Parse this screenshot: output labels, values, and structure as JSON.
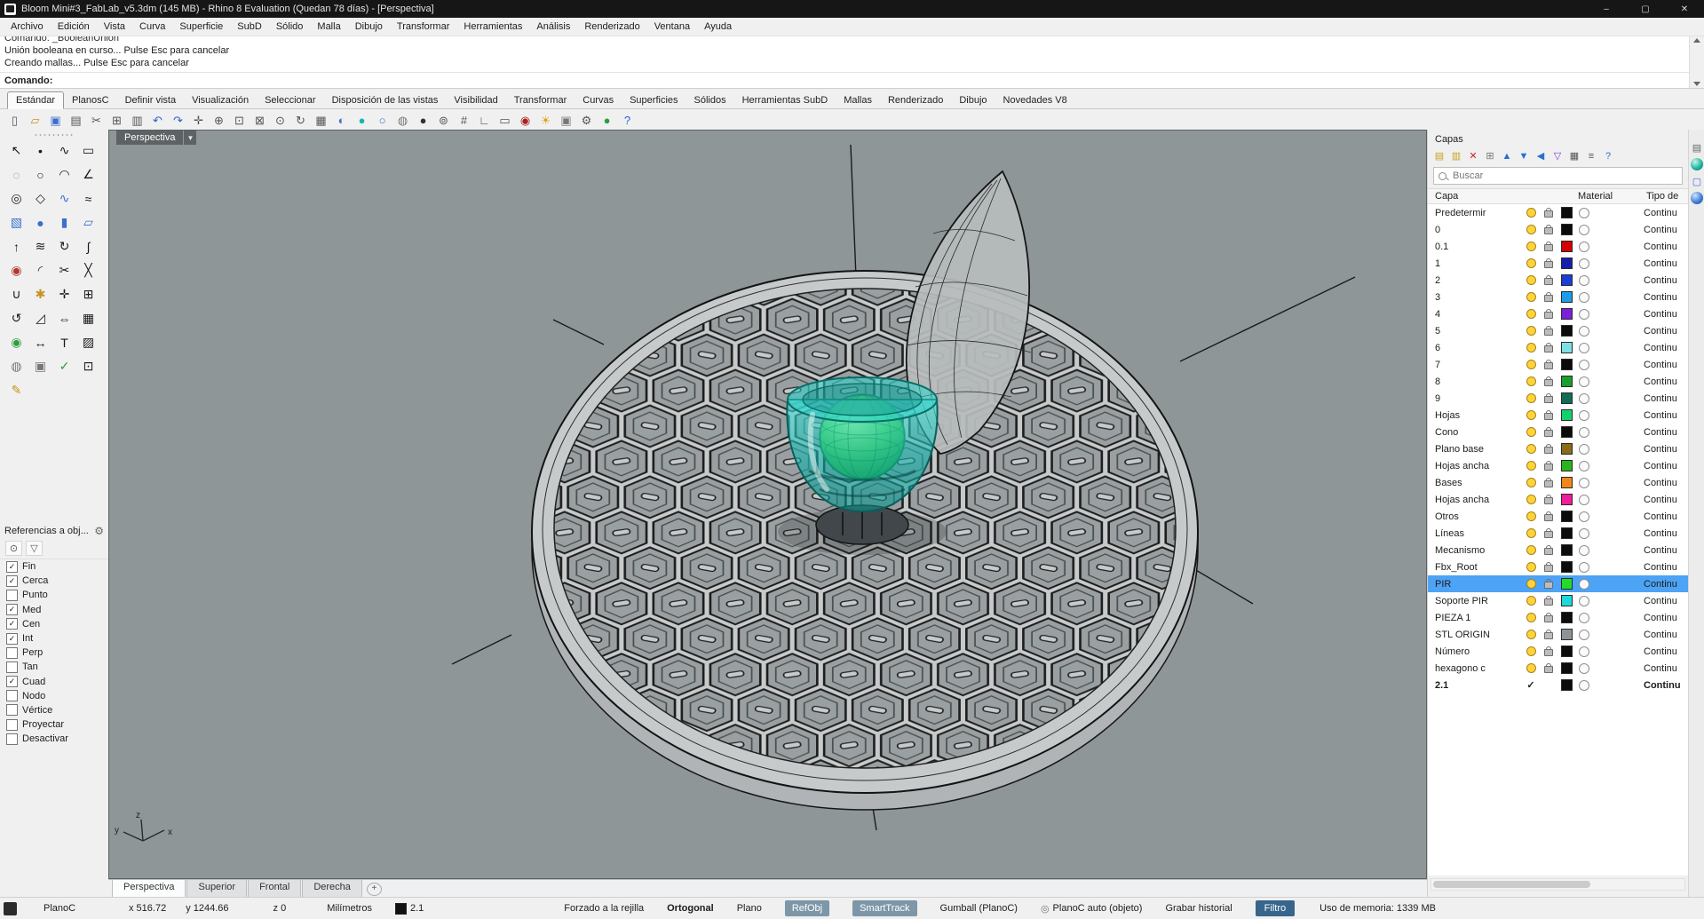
{
  "window": {
    "title": "Bloom Mini#3_FabLab_v5.3dm (145 MB) - Rhino 8 Evaluation (Quedan 78 días) - [Perspectiva]",
    "controls": {
      "minimize": "–",
      "maximize": "▢",
      "close": "✕"
    }
  },
  "menubar": {
    "items": [
      "Archivo",
      "Edición",
      "Vista",
      "Curva",
      "Superficie",
      "SubD",
      "Sólido",
      "Malla",
      "Dibujo",
      "Transformar",
      "Herramientas",
      "Análisis",
      "Renderizado",
      "Ventana",
      "Ayuda"
    ]
  },
  "command_area": {
    "history": [
      "Comando: _BooleanUnion",
      "Unión booleana en curso... Pulse Esc para cancelar",
      "Creando mallas... Pulse Esc para cancelar"
    ],
    "prompt": "Comando:"
  },
  "ribbon": {
    "active": "Estándar",
    "tabs": [
      "Estándar",
      "PlanosC",
      "Definir vista",
      "Visualización",
      "Seleccionar",
      "Disposición de las vistas",
      "Visibilidad",
      "Transformar",
      "Curvas",
      "Superficies",
      "Sólidos",
      "Herramientas SubD",
      "Mallas",
      "Renderizado",
      "Dibujo",
      "Novedades V8"
    ]
  },
  "toolbar": {
    "icons": [
      {
        "name": "new-file",
        "glyph": "▯",
        "color": "#555555"
      },
      {
        "name": "open-file",
        "glyph": "▱",
        "color": "#c8921e"
      },
      {
        "name": "save",
        "glyph": "▣",
        "color": "#3a6fd0"
      },
      {
        "name": "print",
        "glyph": "▤",
        "color": "#555555"
      },
      {
        "name": "cut",
        "glyph": "✂",
        "color": "#555555"
      },
      {
        "name": "copy",
        "glyph": "⊞",
        "color": "#555555"
      },
      {
        "name": "paste",
        "glyph": "▥",
        "color": "#555555"
      },
      {
        "name": "undo",
        "glyph": "↶",
        "color": "#2a5fd0"
      },
      {
        "name": "redo",
        "glyph": "↷",
        "color": "#2a5fd0"
      },
      {
        "name": "pan",
        "glyph": "✛",
        "color": "#555555"
      },
      {
        "name": "zoom-dynamic",
        "glyph": "⊕",
        "color": "#555555"
      },
      {
        "name": "zoom-window",
        "glyph": "⊡",
        "color": "#555555"
      },
      {
        "name": "zoom-extents",
        "glyph": "⊠",
        "color": "#555555"
      },
      {
        "name": "zoom-selected",
        "glyph": "⊙",
        "color": "#555555"
      },
      {
        "name": "rotate-view",
        "glyph": "↻",
        "color": "#555555"
      },
      {
        "name": "named-views",
        "glyph": "▦",
        "color": "#555555"
      },
      {
        "name": "shaded-viewport",
        "glyph": "◐",
        "color": "#3a6fd0"
      },
      {
        "name": "render-sphere",
        "glyph": "●",
        "color": "#18b6ad"
      },
      {
        "name": "wireframe-sphere",
        "glyph": "○",
        "color": "#3a6fd0"
      },
      {
        "name": "ghosted-sphere",
        "glyph": "◍",
        "color": "#777777"
      },
      {
        "name": "raytrace-sphere",
        "glyph": "●",
        "color": "#333333"
      },
      {
        "name": "object-snap",
        "glyph": "⊚",
        "color": "#555555"
      },
      {
        "name": "grid-snap",
        "glyph": "#",
        "color": "#555555"
      },
      {
        "name": "ortho-toggle",
        "glyph": "∟",
        "color": "#555555"
      },
      {
        "name": "planar-mode",
        "glyph": "▭",
        "color": "#555555"
      },
      {
        "name": "record-history",
        "glyph": "◉",
        "color": "#b02020"
      },
      {
        "name": "lamp",
        "glyph": "☀",
        "color": "#e0a010"
      },
      {
        "name": "lock-objects",
        "glyph": "▣",
        "color": "#777777"
      },
      {
        "name": "options-gear",
        "glyph": "⚙",
        "color": "#555555"
      },
      {
        "name": "earth-render",
        "glyph": "●",
        "color": "#2c9e3f"
      },
      {
        "name": "help",
        "glyph": "?",
        "color": "#2a5fd0"
      }
    ]
  },
  "palette": {
    "icons": [
      {
        "name": "select-arrow",
        "glyph": "↖",
        "color": "#1a1a1a"
      },
      {
        "name": "point",
        "glyph": "•",
        "color": "#1a1a1a"
      },
      {
        "name": "control-point-curve",
        "glyph": "∿",
        "color": "#1a1a1a"
      },
      {
        "name": "rectangle",
        "glyph": "▭",
        "color": "#1a1a1a"
      },
      {
        "name": "lasso",
        "glyph": "◌",
        "color": "#777777"
      },
      {
        "name": "circle",
        "glyph": "○",
        "color": "#1a1a1a"
      },
      {
        "name": "arc",
        "glyph": "◠",
        "color": "#1a1a1a"
      },
      {
        "name": "polyline",
        "glyph": "∠",
        "color": "#1a1a1a"
      },
      {
        "name": "ellipse",
        "glyph": "◎",
        "color": "#1a1a1a"
      },
      {
        "name": "polygon",
        "glyph": "◇",
        "color": "#1a1a1a"
      },
      {
        "name": "freeform-curve",
        "glyph": "∿",
        "color": "#3a6fd0"
      },
      {
        "name": "offset-curve",
        "glyph": "≈",
        "color": "#1a1a1a"
      },
      {
        "name": "box",
        "glyph": "▧",
        "color": "#3a6fd0"
      },
      {
        "name": "sphere",
        "glyph": "●",
        "color": "#3a6fd0"
      },
      {
        "name": "cylinder",
        "glyph": "▮",
        "color": "#3a6fd0"
      },
      {
        "name": "plane",
        "glyph": "▱",
        "color": "#3a6fd0"
      },
      {
        "name": "extrude",
        "glyph": "↑",
        "color": "#1a1a1a"
      },
      {
        "name": "loft",
        "glyph": "≋",
        "color": "#1a1a1a"
      },
      {
        "name": "revolve",
        "glyph": "↻",
        "color": "#1a1a1a"
      },
      {
        "name": "sweep",
        "glyph": "∫",
        "color": "#1a1a1a"
      },
      {
        "name": "boolean-union",
        "glyph": "◉",
        "color": "#b0352c"
      },
      {
        "name": "fillet",
        "glyph": "◜",
        "color": "#1a1a1a"
      },
      {
        "name": "trim",
        "glyph": "✂",
        "color": "#1a1a1a"
      },
      {
        "name": "split",
        "glyph": "╳",
        "color": "#1a1a1a"
      },
      {
        "name": "join",
        "glyph": "∪",
        "color": "#1a1a1a"
      },
      {
        "name": "explode",
        "glyph": "✱",
        "color": "#c8921e"
      },
      {
        "name": "move",
        "glyph": "✛",
        "color": "#1a1a1a"
      },
      {
        "name": "copy-object",
        "glyph": "⊞",
        "color": "#1a1a1a"
      },
      {
        "name": "rotate",
        "glyph": "↺",
        "color": "#1a1a1a"
      },
      {
        "name": "scale",
        "glyph": "◿",
        "color": "#1a1a1a"
      },
      {
        "name": "mirror",
        "glyph": "⇔",
        "color": "#1a1a1a"
      },
      {
        "name": "array",
        "glyph": "▦",
        "color": "#1a1a1a"
      },
      {
        "name": "gumball",
        "glyph": "◉",
        "color": "#2c9e3f"
      },
      {
        "name": "dimension",
        "glyph": "↔",
        "color": "#1a1a1a"
      },
      {
        "name": "text",
        "glyph": "T",
        "color": "#1a1a1a"
      },
      {
        "name": "hatch",
        "glyph": "▨",
        "color": "#1a1a1a"
      },
      {
        "name": "hide",
        "glyph": "◍",
        "color": "#777777"
      },
      {
        "name": "lock",
        "glyph": "▣",
        "color": "#777777"
      },
      {
        "name": "check",
        "glyph": "✓",
        "color": "#2c9e3f"
      },
      {
        "name": "group",
        "glyph": "⊡",
        "color": "#1a1a1a"
      },
      {
        "name": "annotate-pencil",
        "glyph": "✎",
        "color": "#c8921e"
      }
    ]
  },
  "osnap": {
    "title": "Referencias a obj...",
    "gear_glyph": "⚙",
    "filter_icons": [
      {
        "name": "project-icon",
        "glyph": "⊙",
        "color": "#555555"
      },
      {
        "name": "filter-icon",
        "glyph": "▽",
        "color": "#555555"
      }
    ],
    "items": [
      {
        "label": "Fin",
        "checked": true
      },
      {
        "label": "Cerca",
        "checked": true
      },
      {
        "label": "Punto",
        "checked": false
      },
      {
        "label": "Med",
        "checked": true
      },
      {
        "label": "Cen",
        "checked": true
      },
      {
        "label": "Int",
        "checked": true
      },
      {
        "label": "Perp",
        "checked": false
      },
      {
        "label": "Tan",
        "checked": false
      },
      {
        "label": "Cuad",
        "checked": true
      },
      {
        "label": "Nodo",
        "checked": false
      },
      {
        "label": "Vértice",
        "checked": false
      },
      {
        "label": "Proyectar",
        "checked": false
      },
      {
        "label": "Desactivar",
        "checked": false
      }
    ]
  },
  "viewport": {
    "label": "Perspectiva",
    "dropdown_glyph": "▼",
    "axis": {
      "x": "x",
      "y": "y",
      "z": "z"
    },
    "tabs": [
      {
        "label": "Perspectiva",
        "active": true
      },
      {
        "label": "Superior",
        "active": false
      },
      {
        "label": "Frontal",
        "active": false
      },
      {
        "label": "Derecha",
        "active": false
      }
    ],
    "add_label": "+"
  },
  "layers": {
    "title": "Capas",
    "search_placeholder": "Buscar",
    "columns": [
      "Capa",
      "Material",
      "Tipo de"
    ],
    "toolbar": [
      {
        "name": "new-layer",
        "glyph": "▤",
        "color": "#c8a21e"
      },
      {
        "name": "new-sublayer",
        "glyph": "▥",
        "color": "#c8a21e"
      },
      {
        "name": "delete-layer",
        "glyph": "✕",
        "color": "#cc2222"
      },
      {
        "name": "match-layer",
        "glyph": "⊞",
        "color": "#777777"
      },
      {
        "name": "move-up",
        "glyph": "▲",
        "color": "#2a6fd0"
      },
      {
        "name": "move-down",
        "glyph": "▼",
        "color": "#2a6fd0"
      },
      {
        "name": "collapse",
        "glyph": "◀",
        "color": "#2a6fd0"
      },
      {
        "name": "filter-funnel",
        "glyph": "▽",
        "color": "#7a3fd0"
      },
      {
        "name": "grid-view",
        "glyph": "▦",
        "color": "#555555"
      },
      {
        "name": "list-menu",
        "glyph": "≡",
        "color": "#555555"
      },
      {
        "name": "help",
        "glyph": "?",
        "color": "#2a6fd0"
      }
    ],
    "rows": [
      {
        "name": "Predetermir",
        "color": "#0b0b0b",
        "linetype": "Continu",
        "selected": false,
        "current": false
      },
      {
        "name": "0",
        "color": "#0b0b0b",
        "linetype": "Continu",
        "selected": false,
        "current": false
      },
      {
        "name": "0.1",
        "color": "#d40000",
        "linetype": "Continu",
        "selected": false,
        "current": false
      },
      {
        "name": "1",
        "color": "#141fae",
        "linetype": "Continu",
        "selected": false,
        "current": false
      },
      {
        "name": "2",
        "color": "#1a3fd4",
        "linetype": "Continu",
        "selected": false,
        "current": false
      },
      {
        "name": "3",
        "color": "#1e9ce8",
        "linetype": "Continu",
        "selected": false,
        "current": false
      },
      {
        "name": "4",
        "color": "#7b20d8",
        "linetype": "Continu",
        "selected": false,
        "current": false
      },
      {
        "name": "5",
        "color": "#0b0b0b",
        "linetype": "Continu",
        "selected": false,
        "current": false
      },
      {
        "name": "6",
        "color": "#7ee0e6",
        "linetype": "Continu",
        "selected": false,
        "current": false
      },
      {
        "name": "7",
        "color": "#0b0b0b",
        "linetype": "Continu",
        "selected": false,
        "current": false
      },
      {
        "name": "8",
        "color": "#1a9e2e",
        "linetype": "Continu",
        "selected": false,
        "current": false
      },
      {
        "name": "9",
        "color": "#0e6e54",
        "linetype": "Continu",
        "selected": false,
        "current": false
      },
      {
        "name": "Hojas",
        "color": "#13d06e",
        "linetype": "Continu",
        "selected": false,
        "current": false
      },
      {
        "name": "Cono",
        "color": "#0b0b0b",
        "linetype": "Continu",
        "selected": false,
        "current": false
      },
      {
        "name": "Plano base",
        "color": "#8a6c16",
        "linetype": "Continu",
        "selected": false,
        "current": false
      },
      {
        "name": "Hojas ancha",
        "color": "#2ab41e",
        "linetype": "Continu",
        "selected": false,
        "current": false
      },
      {
        "name": "Bases",
        "color": "#f08818",
        "linetype": "Continu",
        "selected": false,
        "current": false
      },
      {
        "name": "Hojas ancha",
        "color": "#ee1e9c",
        "linetype": "Continu",
        "selected": false,
        "current": false
      },
      {
        "name": "Otros",
        "color": "#0b0b0b",
        "linetype": "Continu",
        "selected": false,
        "current": false
      },
      {
        "name": "Líneas",
        "color": "#0b0b0b",
        "linetype": "Continu",
        "selected": false,
        "current": false
      },
      {
        "name": "Mecanismo",
        "color": "#0b0b0b",
        "linetype": "Continu",
        "selected": false,
        "current": false
      },
      {
        "name": "Fbx_Root",
        "color": "#0b0b0b",
        "linetype": "Continu",
        "selected": false,
        "current": false
      },
      {
        "name": "PIR",
        "color": "#23dc28",
        "linetype": "Continu",
        "selected": true,
        "current": false
      },
      {
        "name": "Soporte PIR",
        "color": "#1ed8dc",
        "linetype": "Continu",
        "selected": false,
        "current": false
      },
      {
        "name": "PIEZA 1",
        "color": "#0b0b0b",
        "linetype": "Continu",
        "selected": false,
        "current": false
      },
      {
        "name": "STL ORIGIN",
        "color": "#8e9396",
        "linetype": "Continu",
        "selected": false,
        "current": false
      },
      {
        "name": "Número",
        "color": "#0b0b0b",
        "linetype": "Continu",
        "selected": false,
        "current": false
      },
      {
        "name": "hexagono c",
        "color": "#0b0b0b",
        "linetype": "Continu",
        "selected": false,
        "current": false
      },
      {
        "name": "2.1",
        "color": "#0b0b0b",
        "linetype": "Continu",
        "selected": false,
        "current": true
      }
    ],
    "selection_color": "#4da3f5"
  },
  "rightstrip": {
    "icons": [
      {
        "name": "panels-icon",
        "glyph": "▤",
        "color": "#666666",
        "cls": ""
      },
      {
        "name": "render-preview-icon",
        "glyph": "",
        "cls": "ball ball-teal"
      },
      {
        "name": "display-icon",
        "glyph": "▢",
        "color": "#3a6fd0",
        "cls": ""
      },
      {
        "name": "materials-icon",
        "glyph": "",
        "cls": "ball ball-blue"
      }
    ]
  },
  "statusbar": {
    "cplane": "PlanoC",
    "x": "x 516.72",
    "y": "y 1244.66",
    "z": "z 0",
    "units": "Milímetros",
    "active_layer": "2.1",
    "layer_color": "#111111",
    "toggles": [
      {
        "label": "Forzado a la rejilla",
        "style": "plain",
        "icon": false
      },
      {
        "label": "Ortogonal",
        "style": "bold",
        "icon": false
      },
      {
        "label": "Plano",
        "style": "plain",
        "icon": false
      },
      {
        "label": "RefObj",
        "style": "chip",
        "icon": false
      },
      {
        "label": "SmartTrack",
        "style": "chip",
        "icon": false
      },
      {
        "label": "Gumball (PlanoC)",
        "style": "plain",
        "icon": false
      },
      {
        "label": "PlanoC auto (objeto)",
        "style": "plain",
        "icon": true
      },
      {
        "label": "Grabar historial",
        "style": "plain",
        "icon": false
      },
      {
        "label": "Filtro",
        "style": "chipstrong",
        "icon": false
      }
    ],
    "memory": "Uso de memoria: 1339 MB"
  }
}
